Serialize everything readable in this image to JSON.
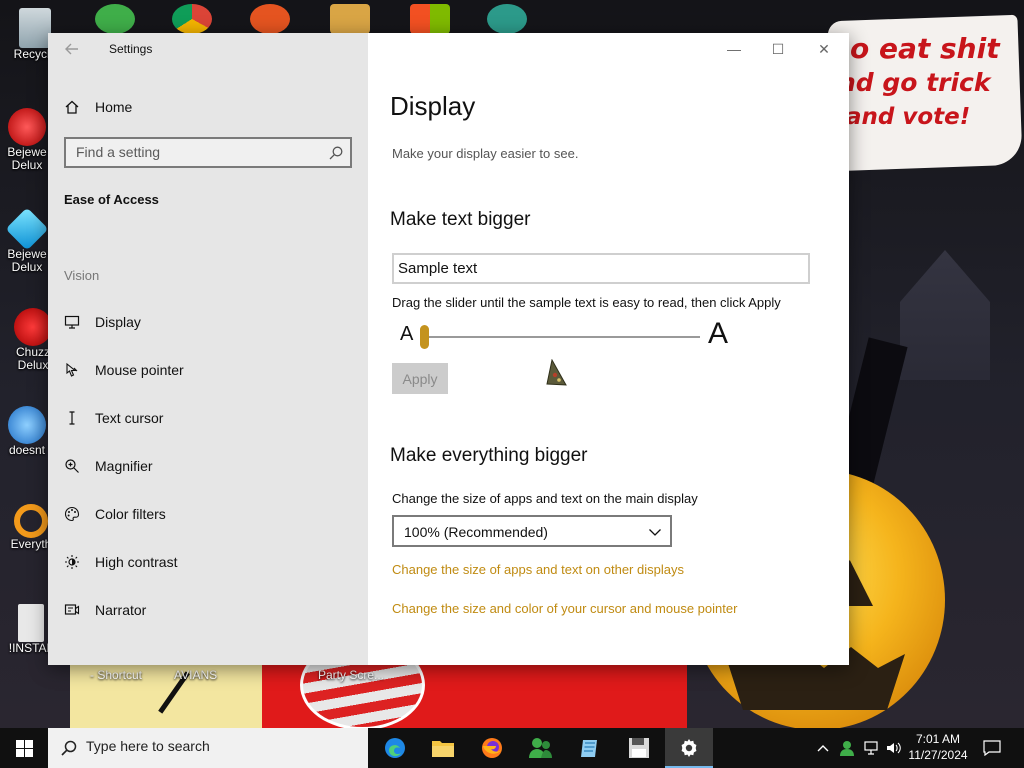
{
  "desktop": {
    "wallpaper_sign": [
      "o eat shit",
      "nd go trick",
      "and vote!"
    ],
    "icons": [
      {
        "label": "Recycle"
      },
      {
        "label": "Bejewe",
        "label2": "Delux"
      },
      {
        "label": "Bejewe",
        "label2": "Delux"
      },
      {
        "label": "Chuzz",
        "label2": "Delux"
      },
      {
        "label": "doesnt"
      },
      {
        "label": "Everyth"
      },
      {
        "label": "!INSTAL"
      },
      {
        "label": "- Shortcut"
      },
      {
        "label": "AVIANS"
      },
      {
        "label": "Party Scre..."
      }
    ]
  },
  "window": {
    "title": "Settings",
    "controls": {
      "minimize": "—",
      "maximize": "☐",
      "close": "✕"
    }
  },
  "nav": {
    "home": "Home",
    "search_placeholder": "Find a setting",
    "section": "Ease of Access",
    "group": "Vision",
    "items": [
      {
        "label": "Display",
        "icon": "monitor-icon"
      },
      {
        "label": "Mouse pointer",
        "icon": "mouse-pointer-icon"
      },
      {
        "label": "Text cursor",
        "icon": "text-cursor-icon"
      },
      {
        "label": "Magnifier",
        "icon": "magnifier-icon"
      },
      {
        "label": "Color filters",
        "icon": "color-filters-icon"
      },
      {
        "label": "High contrast",
        "icon": "high-contrast-icon"
      },
      {
        "label": "Narrator",
        "icon": "narrator-icon"
      }
    ]
  },
  "content": {
    "title": "Display",
    "subtitle": "Make your display easier to see.",
    "text_bigger": {
      "heading": "Make text bigger",
      "sample": "Sample text",
      "hint": "Drag the slider until the sample text is easy to read, then click Apply",
      "slider_small": "A",
      "slider_large": "A",
      "slider_value": 0,
      "apply": "Apply"
    },
    "everything_bigger": {
      "heading": "Make everything bigger",
      "label": "Change the size of apps and text on the main display",
      "dropdown_value": "100% (Recommended)",
      "link1": "Change the size of apps and text on other displays",
      "link2": "Change the size and color of your cursor and mouse pointer"
    },
    "accent_color": "#c08b12"
  },
  "taskbar": {
    "search_placeholder": "Type here to search",
    "apps": [
      "edge-icon",
      "file-explorer-icon",
      "firefox-icon",
      "people-icon",
      "notepad-icon",
      "save-disk-icon",
      "settings-gear-icon"
    ],
    "time": "7:01 AM",
    "date": "11/27/2024"
  }
}
